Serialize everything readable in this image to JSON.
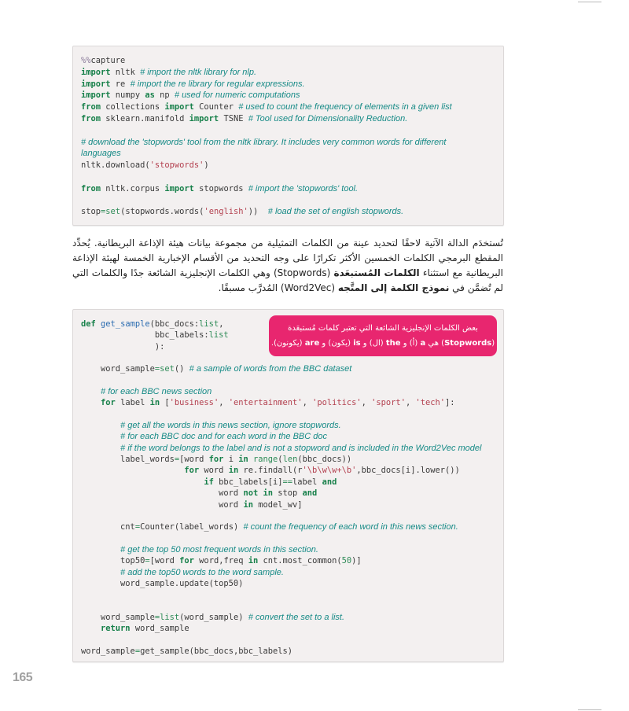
{
  "page_number": "165",
  "colors": {
    "code_bg": "#f3f0f0",
    "keyword": "#17804a",
    "string": "#b3404f",
    "comment": "#168a86",
    "callout_bg": "#e8266f"
  },
  "code_block_1": [
    [
      [
        "magic",
        "%%"
      ],
      [
        "txt",
        "capture"
      ]
    ],
    [
      [
        "kw",
        "import"
      ],
      [
        "txt",
        " nltk "
      ],
      [
        "cm",
        "# import the nltk library for nlp."
      ]
    ],
    [
      [
        "kw",
        "import"
      ],
      [
        "txt",
        " re "
      ],
      [
        "cm",
        "# import the re library for regular expressions."
      ]
    ],
    [
      [
        "kw",
        "import"
      ],
      [
        "txt",
        " numpy "
      ],
      [
        "kw",
        "as"
      ],
      [
        "txt",
        " np "
      ],
      [
        "cm",
        "# used for numeric computations"
      ]
    ],
    [
      [
        "kw",
        "from"
      ],
      [
        "txt",
        " collections "
      ],
      [
        "kw",
        "import"
      ],
      [
        "txt",
        " Counter "
      ],
      [
        "cm",
        "# used to count the frequency of elements in a given list"
      ]
    ],
    [
      [
        "kw",
        "from"
      ],
      [
        "txt",
        " sklearn.manifold "
      ],
      [
        "kw",
        "import"
      ],
      [
        "txt",
        " TSNE "
      ],
      [
        "cm",
        "# Tool used for Dimensionality Reduction."
      ]
    ],
    [],
    [
      [
        "cm",
        "# download the 'stopwords' tool from the nltk library. It includes very common words for different"
      ]
    ],
    [
      [
        "cm",
        "languages"
      ]
    ],
    [
      [
        "txt",
        "nltk.download("
      ],
      [
        "str",
        "'stopwords'"
      ],
      [
        "txt",
        ")"
      ]
    ],
    [],
    [
      [
        "kw",
        "from"
      ],
      [
        "txt",
        " nltk.corpus "
      ],
      [
        "kw",
        "import"
      ],
      [
        "txt",
        " stopwords "
      ],
      [
        "cm",
        "# import the 'stopwords' tool."
      ]
    ],
    [],
    [
      [
        "txt",
        "stop"
      ],
      [
        "op",
        "="
      ],
      [
        "bi",
        "set"
      ],
      [
        "txt",
        "(stopwords.words("
      ],
      [
        "str",
        "'english'"
      ],
      [
        "txt",
        "))  "
      ],
      [
        "cm",
        "# load the set of english stopwords."
      ]
    ]
  ],
  "paragraph": {
    "part1": "تُستخدَم الدالة الآتية لاحقًا لتحديد عينة من الكلمات التمثيلية من مجموعة بيانات هيئة الإذاعة البريطانية. يُحدِّد المقطع البرمجي الكلمات الخمسين الأكثر تكرارًا على وجه التحديد من الأقسام الإخبارية الخمسة لهيئة الإذاعة البريطانية مع استثناء ",
    "bold1": "الكلمات المُستبعَدة",
    "part2": " (Stopwords) وهي الكلمات الإنجليزية الشائعة جدًا والكلمات التي لم تُضمَّن في ",
    "bold2": "نموذج الكلمة إلى المتَّجه",
    "part3": " (Word2Vec) المُدرَّب مسبقًا."
  },
  "callout": {
    "line1": "بعض الكلمات الإنجليزية الشائعة التي تعتبر كلمات مُستبعَدة",
    "segments": [
      {
        "text": "(",
        "bold": false
      },
      {
        "text": "Stopwords",
        "bold": true
      },
      {
        "text": ") هي ",
        "bold": false
      },
      {
        "text": "a",
        "bold": true
      },
      {
        "text": " (أ) و ",
        "bold": false
      },
      {
        "text": "the",
        "bold": true
      },
      {
        "text": " (ال) و ",
        "bold": false
      },
      {
        "text": "is",
        "bold": true
      },
      {
        "text": " (يكون) و ",
        "bold": false
      },
      {
        "text": "are",
        "bold": true
      },
      {
        "text": " (يكونون).",
        "bold": false
      }
    ]
  },
  "code_block_2": [
    [
      [
        "kw",
        "def"
      ],
      [
        "txt",
        " "
      ],
      [
        "fn",
        "get_sample"
      ],
      [
        "txt",
        "(bbc_docs:"
      ],
      [
        "bi",
        "list"
      ],
      [
        "txt",
        ","
      ]
    ],
    [
      [
        "txt",
        "               bbc_labels:"
      ],
      [
        "bi",
        "list"
      ]
    ],
    [
      [
        "txt",
        "               ):"
      ]
    ],
    [],
    [
      [
        "txt",
        "    word_sample"
      ],
      [
        "op",
        "="
      ],
      [
        "bi",
        "set"
      ],
      [
        "txt",
        "() "
      ],
      [
        "cm",
        "# a sample of words from the BBC dataset"
      ]
    ],
    [],
    [
      [
        "txt",
        "    "
      ],
      [
        "cm",
        "# for each BBC news section"
      ]
    ],
    [
      [
        "txt",
        "    "
      ],
      [
        "kw",
        "for"
      ],
      [
        "txt",
        " label "
      ],
      [
        "kw",
        "in"
      ],
      [
        "txt",
        " ["
      ],
      [
        "str",
        "'business'"
      ],
      [
        "txt",
        ", "
      ],
      [
        "str",
        "'entertainment'"
      ],
      [
        "txt",
        ", "
      ],
      [
        "str",
        "'politics'"
      ],
      [
        "txt",
        ", "
      ],
      [
        "str",
        "'sport'"
      ],
      [
        "txt",
        ", "
      ],
      [
        "str",
        "'tech'"
      ],
      [
        "txt",
        "]:"
      ]
    ],
    [],
    [
      [
        "txt",
        "        "
      ],
      [
        "cm",
        "# get all the words in this news section, ignore stopwords."
      ]
    ],
    [
      [
        "txt",
        "        "
      ],
      [
        "cm",
        "# for each BBC doc and for each word in the BBC doc"
      ]
    ],
    [
      [
        "txt",
        "        "
      ],
      [
        "cm",
        "# if the word belongs to the label and is not a stopword and is included in the Word2Vec model"
      ]
    ],
    [
      [
        "txt",
        "        label_words"
      ],
      [
        "op",
        "="
      ],
      [
        "txt",
        "[word "
      ],
      [
        "kw",
        "for"
      ],
      [
        "txt",
        " i "
      ],
      [
        "kw",
        "in"
      ],
      [
        "txt",
        " "
      ],
      [
        "bi",
        "range"
      ],
      [
        "txt",
        "("
      ],
      [
        "bi",
        "len"
      ],
      [
        "txt",
        "(bbc_docs))"
      ]
    ],
    [
      [
        "txt",
        "                     "
      ],
      [
        "kw",
        "for"
      ],
      [
        "txt",
        " word "
      ],
      [
        "kw",
        "in"
      ],
      [
        "txt",
        " re.findall(r"
      ],
      [
        "str",
        "'\\b\\w\\w+\\b'"
      ],
      [
        "txt",
        ",bbc_docs[i].lower())"
      ]
    ],
    [
      [
        "txt",
        "                         "
      ],
      [
        "kw",
        "if"
      ],
      [
        "txt",
        " bbc_labels[i]"
      ],
      [
        "op",
        "=="
      ],
      [
        "txt",
        "label "
      ],
      [
        "kw",
        "and"
      ]
    ],
    [
      [
        "txt",
        "                            word "
      ],
      [
        "kw",
        "not in"
      ],
      [
        "txt",
        " stop "
      ],
      [
        "kw",
        "and"
      ]
    ],
    [
      [
        "txt",
        "                            word "
      ],
      [
        "kw",
        "in"
      ],
      [
        "txt",
        " model_wv]"
      ]
    ],
    [],
    [
      [
        "txt",
        "        cnt"
      ],
      [
        "op",
        "="
      ],
      [
        "txt",
        "Counter(label_words) "
      ],
      [
        "cm",
        "# count the frequency of each word in this news section."
      ]
    ],
    [],
    [
      [
        "txt",
        "        "
      ],
      [
        "cm",
        "# get the top 50 most frequent words in this section."
      ]
    ],
    [
      [
        "txt",
        "        top50"
      ],
      [
        "op",
        "="
      ],
      [
        "txt",
        "[word "
      ],
      [
        "kw",
        "for"
      ],
      [
        "txt",
        " word,freq "
      ],
      [
        "kw",
        "in"
      ],
      [
        "txt",
        " cnt.most_common("
      ],
      [
        "num",
        "50"
      ],
      [
        "txt",
        ")]"
      ]
    ],
    [
      [
        "txt",
        "        "
      ],
      [
        "cm",
        "# add the top50 words to the word sample."
      ]
    ],
    [
      [
        "txt",
        "        word_sample.update(top50)"
      ]
    ],
    [],
    [],
    [
      [
        "txt",
        "    word_sample"
      ],
      [
        "op",
        "="
      ],
      [
        "bi",
        "list"
      ],
      [
        "txt",
        "(word_sample) "
      ],
      [
        "cm",
        "# convert the set to a list."
      ]
    ],
    [
      [
        "txt",
        "    "
      ],
      [
        "kw",
        "return"
      ],
      [
        "txt",
        " word_sample"
      ]
    ],
    [],
    [
      [
        "txt",
        "word_sample"
      ],
      [
        "op",
        "="
      ],
      [
        "txt",
        "get_sample(bbc_docs,bbc_labels)"
      ]
    ]
  ]
}
